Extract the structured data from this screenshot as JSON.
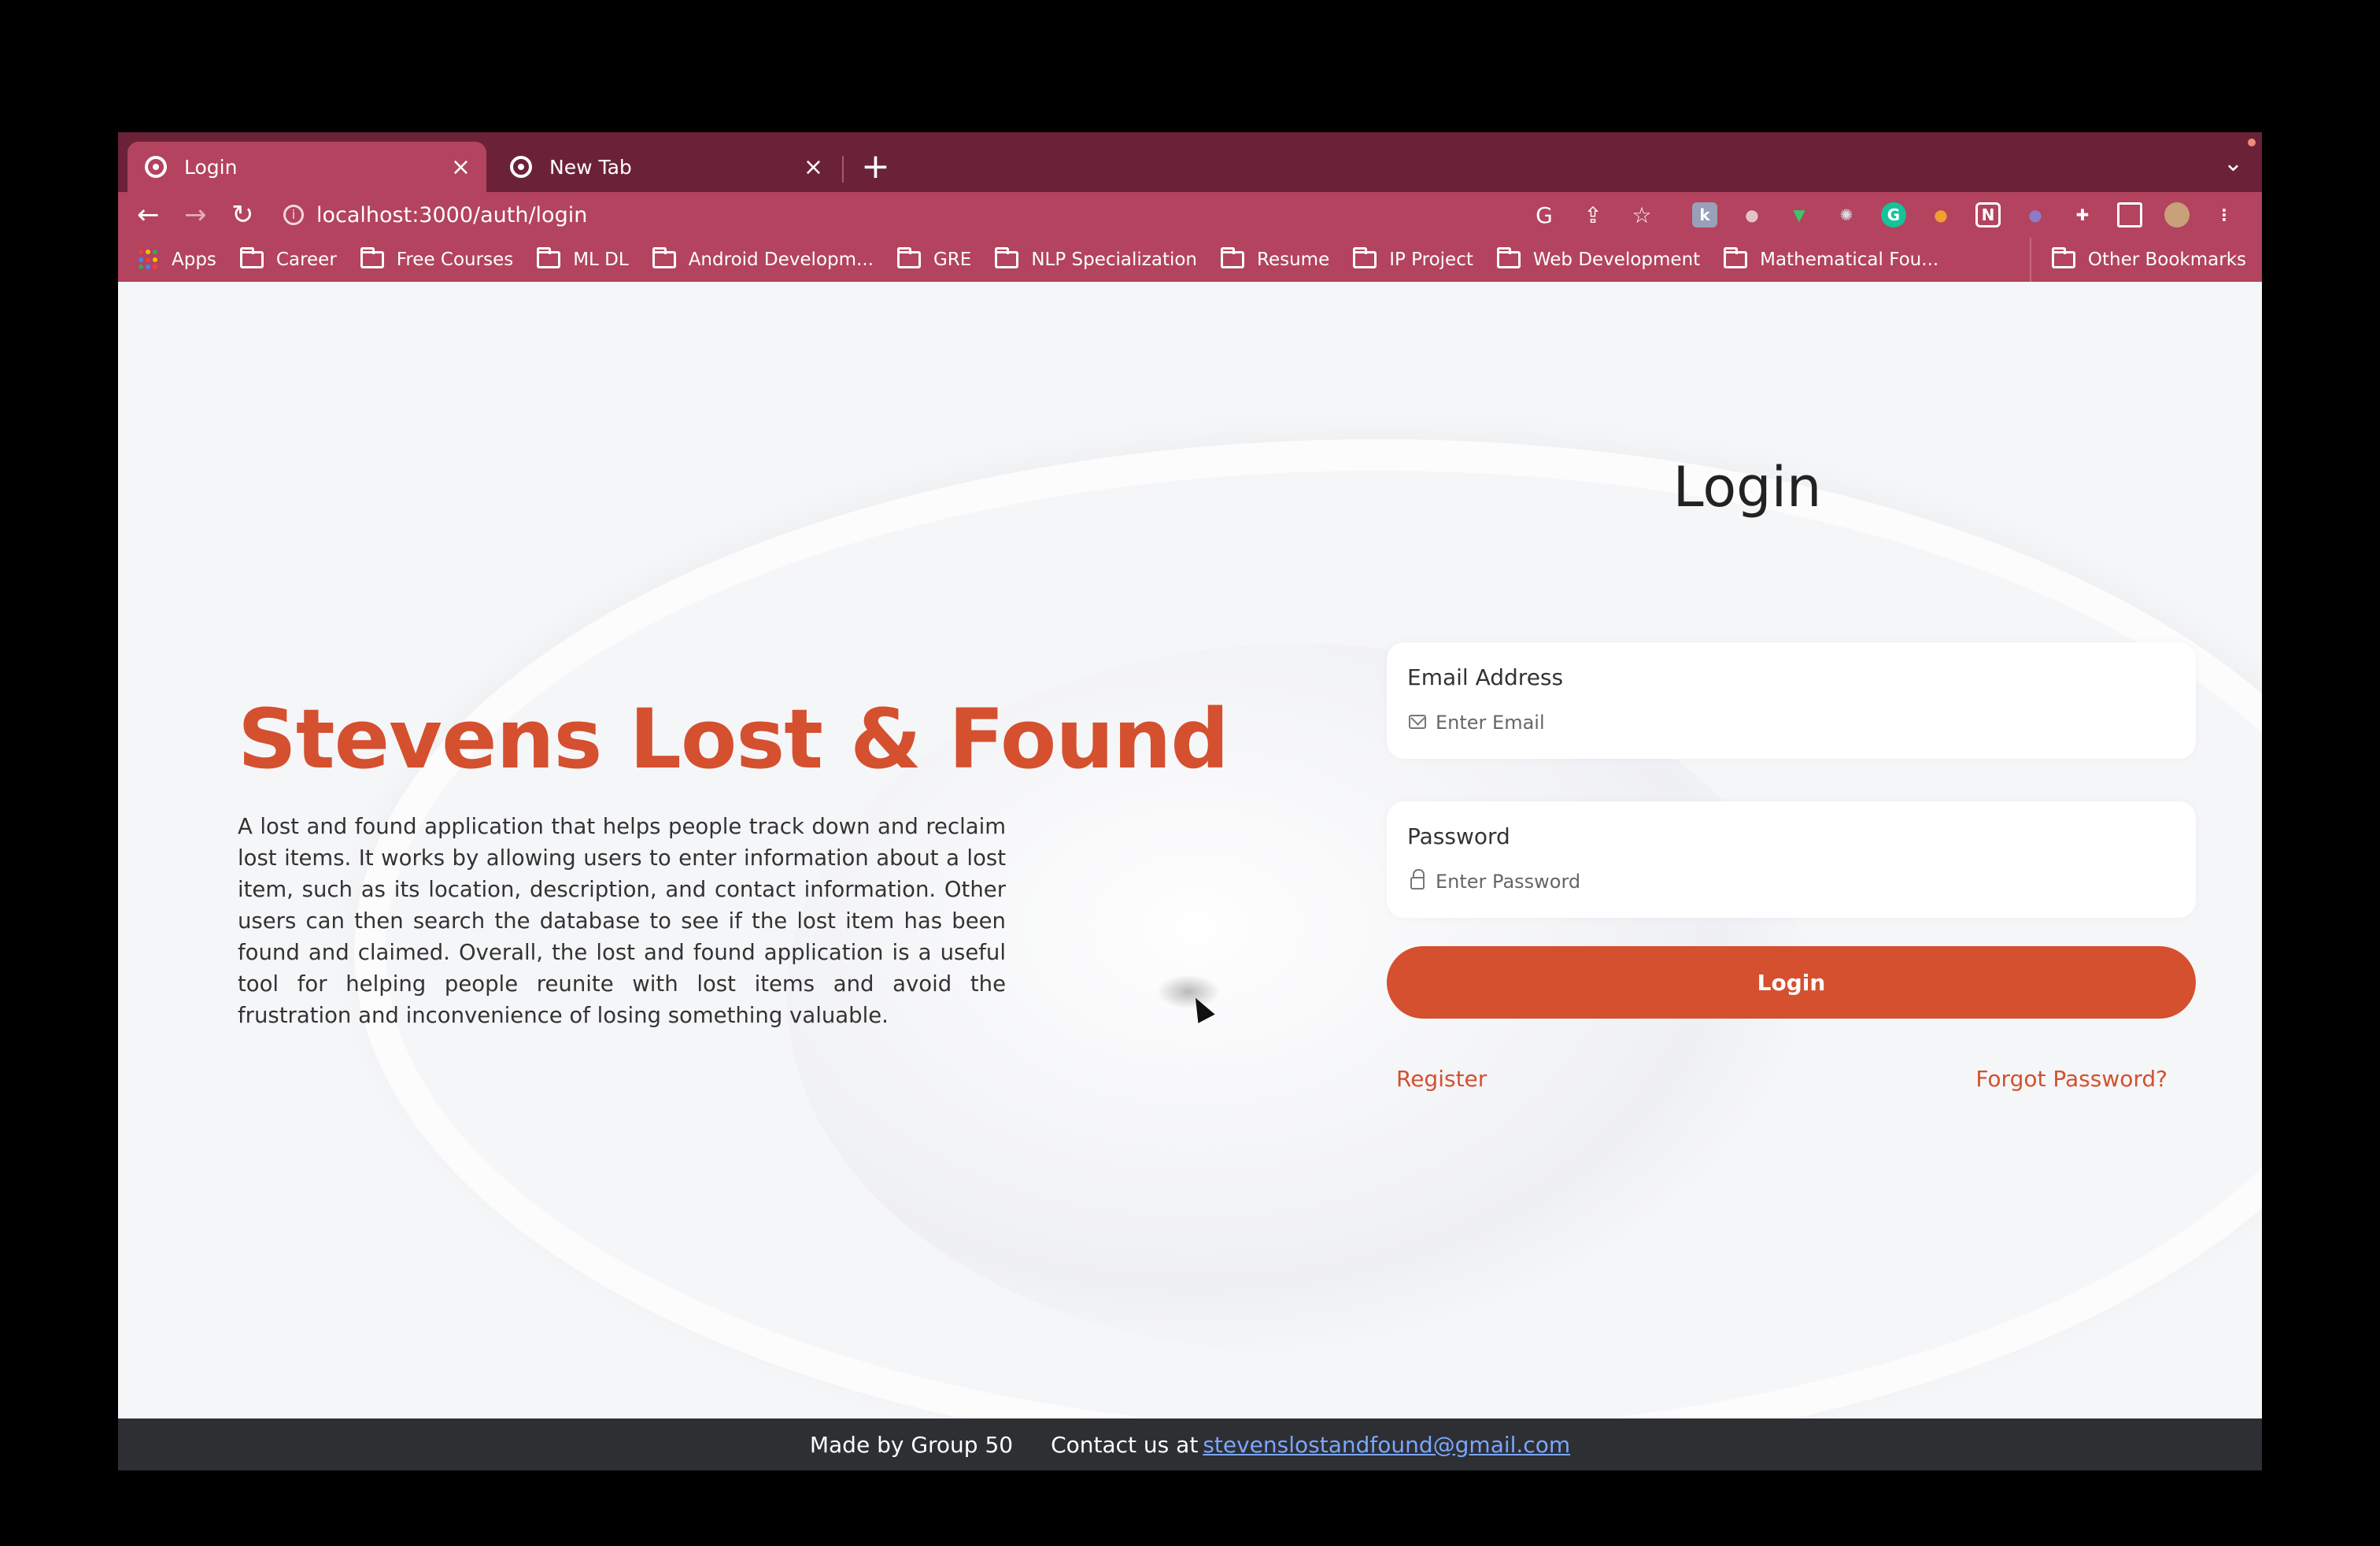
{
  "browser": {
    "tabs": [
      {
        "label": "Login",
        "active": true
      },
      {
        "label": "New Tab",
        "active": false
      }
    ],
    "new_tab_symbol": "+",
    "close_symbol": "×",
    "url": "localhost:3000/auth/login",
    "bookmarks": [
      {
        "label": "Apps",
        "icon": "apps-grid-icon"
      },
      {
        "label": "Career",
        "icon": "folder-icon"
      },
      {
        "label": "Free Courses",
        "icon": "folder-icon"
      },
      {
        "label": "ML DL",
        "icon": "folder-icon"
      },
      {
        "label": "Android Developm...",
        "icon": "folder-icon"
      },
      {
        "label": "GRE",
        "icon": "folder-icon"
      },
      {
        "label": "NLP Specialization",
        "icon": "folder-icon"
      },
      {
        "label": "Resume",
        "icon": "folder-icon"
      },
      {
        "label": "IP Project",
        "icon": "folder-icon"
      },
      {
        "label": "Web Development",
        "icon": "folder-icon"
      },
      {
        "label": "Mathematical Fou...",
        "icon": "folder-icon"
      }
    ],
    "other_bookmarks": "Other Bookmarks",
    "colors": {
      "tab_strip": "#6b2238",
      "toolbar": "#b3435e"
    }
  },
  "hero": {
    "title": "Stevens Lost & Found",
    "description": "A lost and found application that helps people track down and reclaim lost items. It works by allowing users to enter information about a lost item, such as its location, description, and contact information. Other users can then search the database to see if the lost item has been found and claimed. Overall, the lost and found application is a useful tool for helping people reunite with lost items and avoid the frustration and inconvenience of losing something valuable."
  },
  "login": {
    "title": "Login",
    "email": {
      "label": "Email Address",
      "placeholder": "Enter Email",
      "value": ""
    },
    "password": {
      "label": "Password",
      "placeholder": "Enter Password",
      "value": ""
    },
    "submit_label": "Login",
    "register_label": "Register",
    "forgot_label": "Forgot Password?"
  },
  "footer": {
    "made_by": "Made by Group 50",
    "contact_prefix": "Contact us at",
    "contact_email": "stevenslostandfound@gmail.com"
  },
  "theme": {
    "accent": "#d4502f",
    "footer_bg": "#2d2f33",
    "link": "#7aa6ff"
  }
}
